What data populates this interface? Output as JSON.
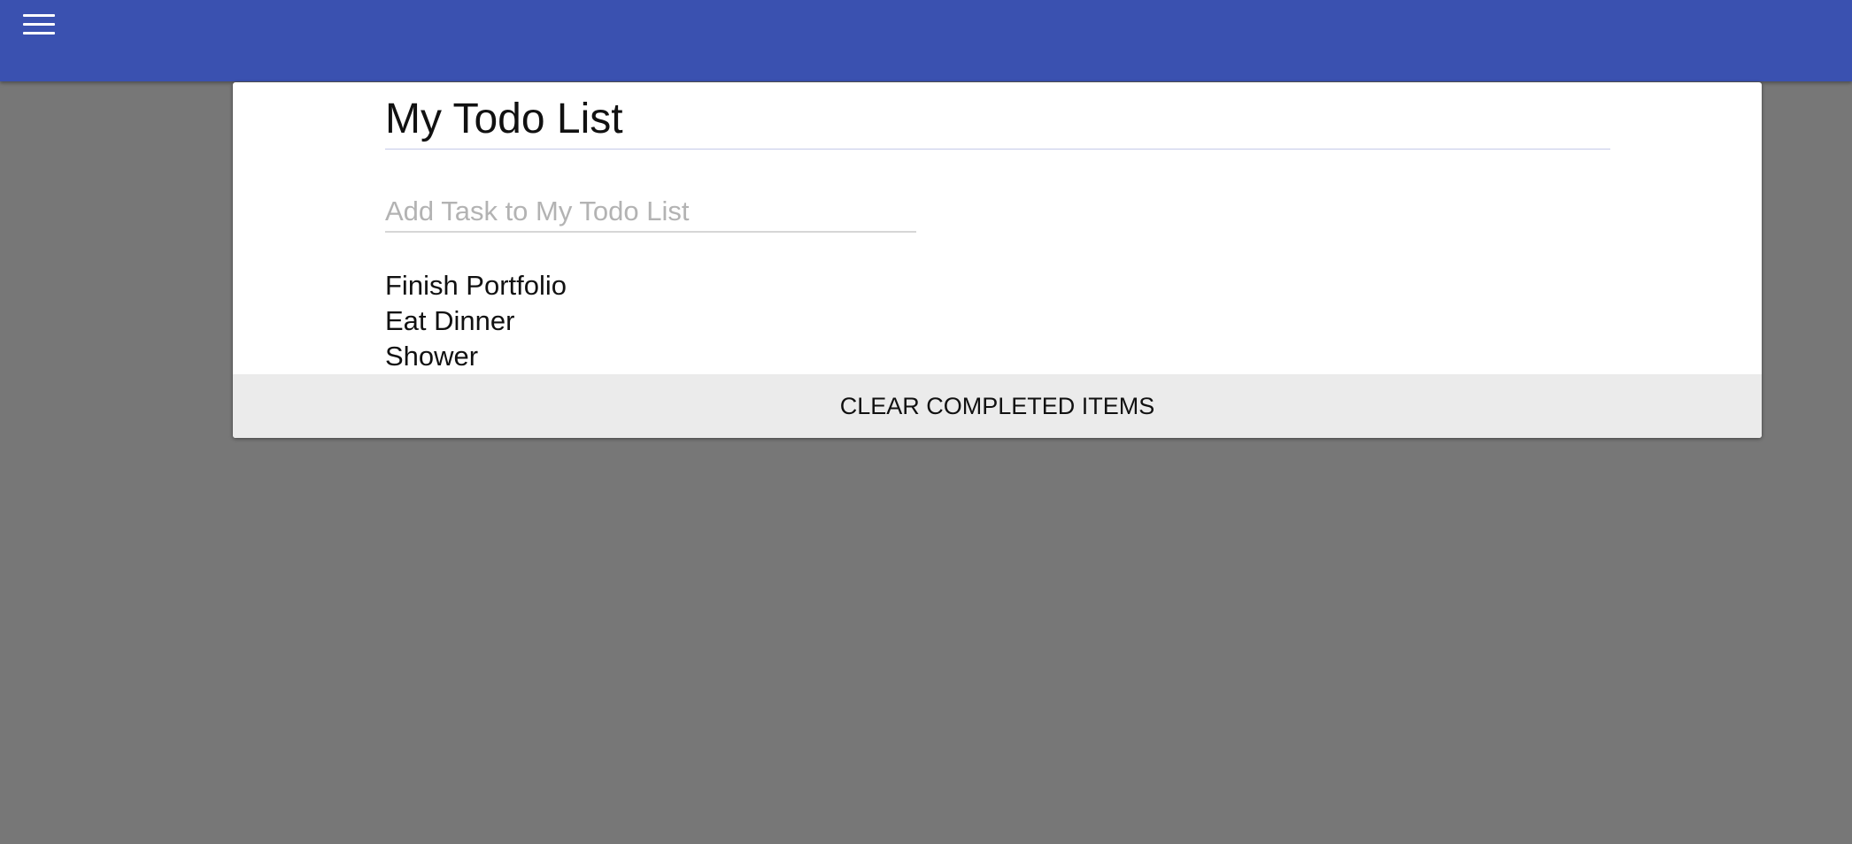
{
  "app_bar": {
    "menu_icon": "hamburger-menu-icon",
    "color": "#3a51b0"
  },
  "card": {
    "title": "My Todo List",
    "input": {
      "value": "",
      "placeholder": "Add Task to My Todo List"
    },
    "tasks": [
      {
        "label": "Finish Portfolio"
      },
      {
        "label": "Eat Dinner"
      },
      {
        "label": "Shower"
      }
    ],
    "clear_button_label": "CLEAR COMPLETED ITEMS"
  },
  "colors": {
    "background": "#777777",
    "card": "#ffffff",
    "footer": "#ebebeb"
  }
}
